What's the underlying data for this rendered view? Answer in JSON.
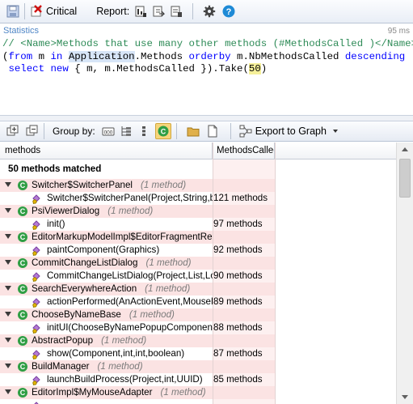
{
  "toolbar": {
    "critical_label": "Critical",
    "report_label": "Report:"
  },
  "editor": {
    "title": "Statistics",
    "time": "95 ms",
    "line1_comment": "// <Name>Methods that use many other methods (#MethodsCalled )</Name>",
    "line2_pre": "(",
    "line2_from": "from",
    "line2_m": " m ",
    "line2_in": "in",
    "line2_sp": " ",
    "line2_app": "Application",
    "line2_mid": ".Methods ",
    "line2_orderby": "orderby",
    "line2_mid2": " m.NbMethodsCalled ",
    "line2_desc": "descending",
    "line3_sp": " ",
    "line3_select": "select",
    "line3_sp2": " ",
    "line3_new": "new",
    "line3_mid": " { m, m.MethodsCalled }).Take(",
    "line3_num": "50",
    "line3_end": ")"
  },
  "results_toolbar": {
    "group_by_label": "Group by:",
    "export_label": "Export to Graph"
  },
  "grid": {
    "columns": [
      "methods",
      "MethodsCalled"
    ],
    "summary": "50 methods matched",
    "rows": [
      {
        "kind": "type",
        "name": "Switcher$SwitcherPanel",
        "count": "(1 method)"
      },
      {
        "kind": "method",
        "name": "Switcher$SwitcherPanel(Project,String,bo",
        "value": "121 methods"
      },
      {
        "kind": "type",
        "name": "PsiViewerDialog",
        "count": "(1 method)"
      },
      {
        "kind": "method",
        "name": "init()",
        "value": "97 methods"
      },
      {
        "kind": "type",
        "name": "EditorMarkupModelImpl$EditorFragmentRenc",
        "count": ""
      },
      {
        "kind": "method",
        "name": "paintComponent(Graphics)",
        "value": "92 methods"
      },
      {
        "kind": "type",
        "name": "CommitChangeListDialog",
        "count": "(1 method)"
      },
      {
        "kind": "method",
        "name": "CommitChangeListDialog(Project,List,Loc",
        "value": "90 methods"
      },
      {
        "kind": "type",
        "name": "SearchEverywhereAction",
        "count": "(1 method)"
      },
      {
        "kind": "method",
        "name": "actionPerformed(AnActionEvent,MouseEv",
        "value": "89 methods"
      },
      {
        "kind": "type",
        "name": "ChooseByNameBase",
        "count": "(1 method)"
      },
      {
        "kind": "method",
        "name": "initUI(ChooseByNamePopupComponent$I",
        "value": "88 methods"
      },
      {
        "kind": "type",
        "name": "AbstractPopup",
        "count": "(1 method)"
      },
      {
        "kind": "method",
        "name": "show(Component,int,int,boolean)",
        "value": "87 methods"
      },
      {
        "kind": "type",
        "name": "BuildManager",
        "count": "(1 method)"
      },
      {
        "kind": "method",
        "name": "launchBuildProcess(Project,int,UUID)",
        "value": "85 methods"
      },
      {
        "kind": "type",
        "name": "EditorImpl$MyMouseAdapter",
        "count": "(1 method)"
      },
      {
        "kind": "method",
        "name": "",
        "value": ""
      }
    ]
  },
  "colors": {
    "accent_blue": "#4f86c6",
    "type_row_bg": "#fbe3e3",
    "green_type_icon": "#2f9e44"
  }
}
